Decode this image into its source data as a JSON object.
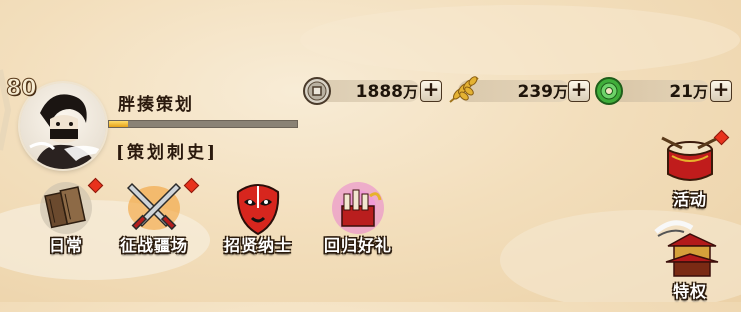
{
  "player": {
    "level": "80",
    "name": "胖揍策划",
    "title": "[策划刺史]",
    "exp_fraction": 0.1
  },
  "resources": [
    {
      "icon": "coin-icon",
      "value": "1888",
      "unit": "万"
    },
    {
      "icon": "grain-icon",
      "value": "239",
      "unit": "万"
    },
    {
      "icon": "jade-icon",
      "value": "21",
      "unit": "万"
    }
  ],
  "menu": [
    {
      "id": "daily",
      "label": "日常",
      "icon": "book-icon",
      "badge": true
    },
    {
      "id": "campaign",
      "label": "征战疆场",
      "icon": "crossed-swords-icon",
      "badge": true
    },
    {
      "id": "recruit",
      "label": "招贤纳士",
      "icon": "opera-mask-icon",
      "badge": false
    },
    {
      "id": "return",
      "label": "回归好礼",
      "icon": "gift-box-icon",
      "badge": false
    }
  ],
  "side_menu": [
    {
      "id": "events",
      "label": "活动",
      "icon": "drum-icon",
      "badge": true
    },
    {
      "id": "privilege",
      "label": "特权",
      "icon": "pavilion-icon",
      "badge": false
    }
  ],
  "colors": {
    "badge": "#e8321c",
    "exp_fill": "#e5a21a"
  }
}
